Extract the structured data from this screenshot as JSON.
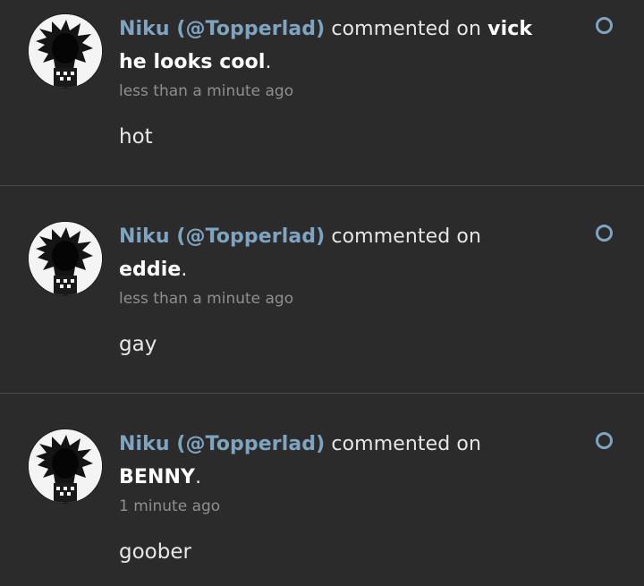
{
  "notifications": [
    {
      "author": "Niku (@Topperlad)",
      "action": "commented on",
      "target": "vick he looks cool",
      "time": "less than a minute ago",
      "comment": "hot"
    },
    {
      "author": "Niku (@Topperlad)",
      "action": "commented on",
      "target": "eddie",
      "time": "less than a minute ago",
      "comment": "gay"
    },
    {
      "author": "Niku (@Topperlad)",
      "action": "commented on",
      "target": "BENNY",
      "time": "1 minute ago",
      "comment": "goober"
    }
  ],
  "icons": {
    "avatar": "hedgehog-avatar-icon",
    "read_toggle": "circle-outline-icon"
  },
  "colors": {
    "background": "#2b2b2b",
    "author": "#7fa4c0",
    "text": "#e6e6e6",
    "muted": "#8f8f8f",
    "divider": "#4a4a4a"
  }
}
